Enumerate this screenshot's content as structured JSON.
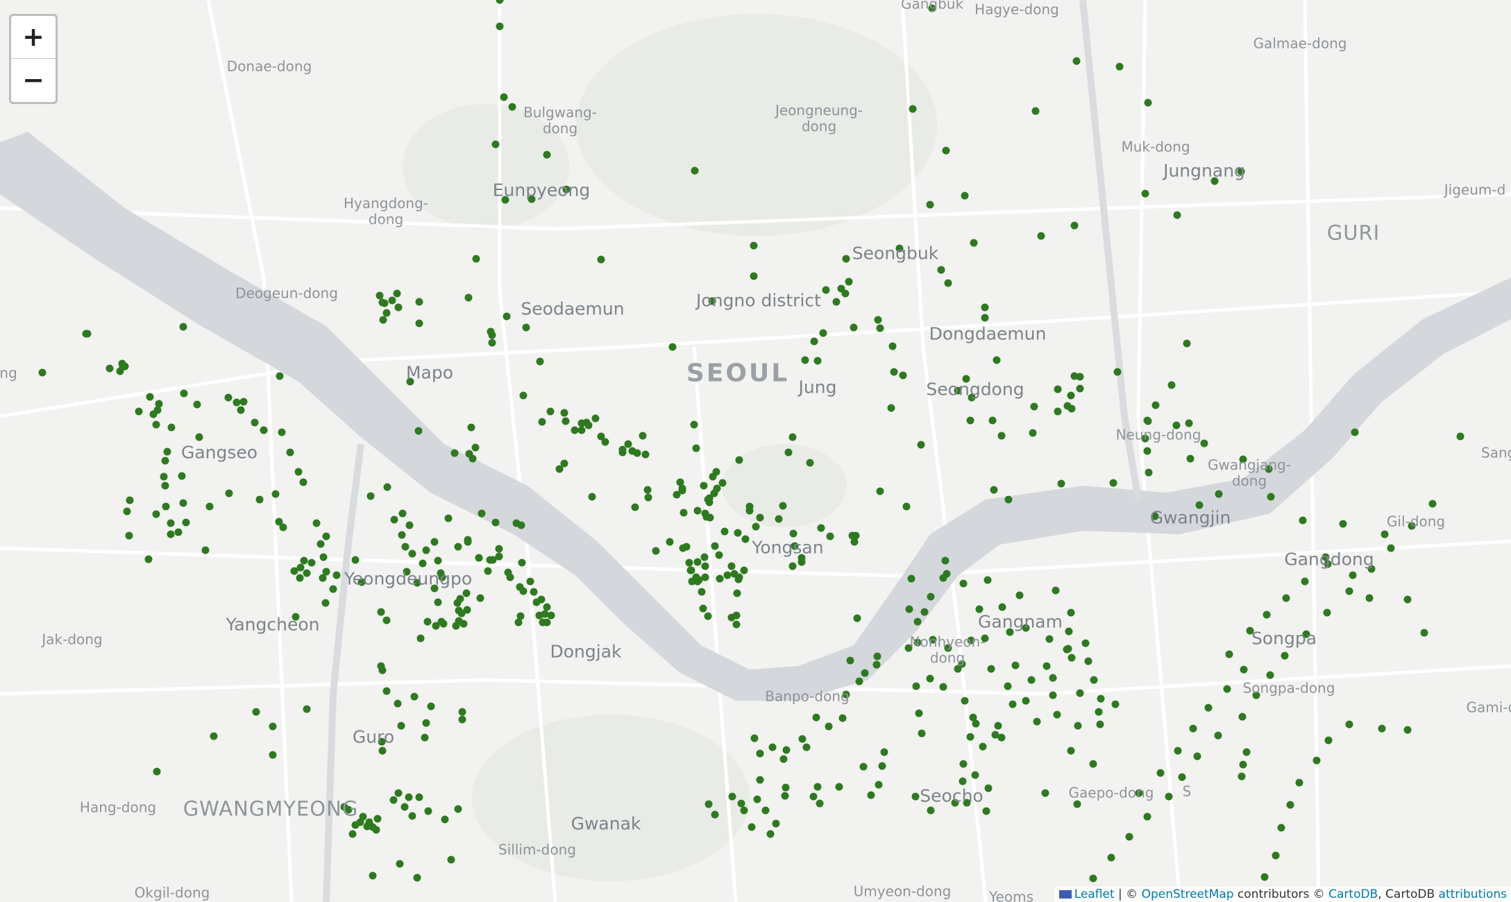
{
  "map": {
    "zoom_controls": {
      "zoom_in": "+",
      "zoom_out": "−"
    },
    "place_labels": [
      {
        "text": "Gangbuk",
        "kind": "small"
      },
      {
        "text": "Hagye-dong",
        "kind": "small"
      },
      {
        "text": "Galmae-dong",
        "kind": "small"
      },
      {
        "text": "Donae-dong",
        "kind": "small"
      },
      {
        "text": "Bulgwang-\ndong",
        "kind": "small"
      },
      {
        "text": "Jeongneung-\ndong",
        "kind": "small"
      },
      {
        "text": "Muk-dong",
        "kind": "small"
      },
      {
        "text": "Jungnang",
        "kind": "district"
      },
      {
        "text": "Jigeum-d",
        "kind": "small"
      },
      {
        "text": "Eunpyeong",
        "kind": "district"
      },
      {
        "text": "Hyangdong-\ndong",
        "kind": "small"
      },
      {
        "text": "GURI",
        "kind": "city"
      },
      {
        "text": "Seongbuk",
        "kind": "district"
      },
      {
        "text": "Deogeun-dong",
        "kind": "small"
      },
      {
        "text": "Seodaemun",
        "kind": "district"
      },
      {
        "text": "Jongno district",
        "kind": "district"
      },
      {
        "text": "Dongdaemun",
        "kind": "district"
      },
      {
        "text": "ong",
        "kind": "small"
      },
      {
        "text": "Mapo",
        "kind": "district"
      },
      {
        "text": "SEOUL",
        "kind": "capital"
      },
      {
        "text": "Jung",
        "kind": "district"
      },
      {
        "text": "Seongdong",
        "kind": "district"
      },
      {
        "text": "Neung-dong",
        "kind": "small"
      },
      {
        "text": "Gangseo",
        "kind": "district"
      },
      {
        "text": "Gwangjang-\ndong",
        "kind": "small"
      },
      {
        "text": "Sangi",
        "kind": "small"
      },
      {
        "text": "Gwangjin",
        "kind": "district"
      },
      {
        "text": "Gil-dong",
        "kind": "small"
      },
      {
        "text": "Yongsan",
        "kind": "district"
      },
      {
        "text": "Gangdong",
        "kind": "district"
      },
      {
        "text": "Yeongdeungpo",
        "kind": "district"
      },
      {
        "text": "Gangnam",
        "kind": "district"
      },
      {
        "text": "Yangcheon",
        "kind": "district"
      },
      {
        "text": "Jak-dong",
        "kind": "small"
      },
      {
        "text": "Songpa",
        "kind": "district"
      },
      {
        "text": "Nonhyeon-\ndong",
        "kind": "small"
      },
      {
        "text": "Dongjak",
        "kind": "district"
      },
      {
        "text": "Banpo-dong",
        "kind": "small"
      },
      {
        "text": "Songpa-dong",
        "kind": "small"
      },
      {
        "text": "Gami-do",
        "kind": "small"
      },
      {
        "text": "Guro",
        "kind": "district"
      },
      {
        "text": "Seocho",
        "kind": "district"
      },
      {
        "text": "Gaepo-dong",
        "kind": "small"
      },
      {
        "text": "S",
        "kind": "small"
      },
      {
        "text": "Hang-dong",
        "kind": "small"
      },
      {
        "text": "GWANGMYEONG",
        "kind": "city"
      },
      {
        "text": "Gwanak",
        "kind": "district"
      },
      {
        "text": "Sillim-dong",
        "kind": "small"
      },
      {
        "text": "Okgil-dong",
        "kind": "small"
      },
      {
        "text": "Umyeon-dong",
        "kind": "small"
      },
      {
        "text": "Yeoms",
        "kind": "small"
      }
    ],
    "marker_color": "#2d7a1f",
    "water_color": "#d4d8dc",
    "attribution": {
      "leaflet": "Leaflet",
      "separator": " | © ",
      "osm": "OpenStreetMap",
      "contrib": " contributors © ",
      "carto": "CartoDB",
      "tail": ", CartoDB ",
      "attributions": "attributions"
    }
  }
}
